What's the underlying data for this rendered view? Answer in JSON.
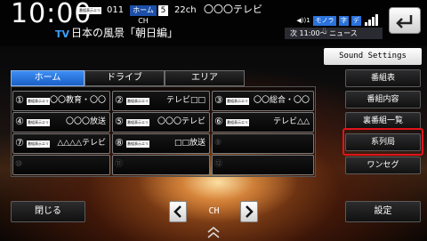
{
  "header": {
    "clock": "10:00",
    "tag": "番組表示エリア",
    "channel_code": "011",
    "home_ch_label": "ホームCH",
    "home_ch_num": "5",
    "channel_no": "22ch",
    "station": "〇〇〇テレビ",
    "tv_label": "TV",
    "program_title": "日本の風景「朝日編」",
    "status": {
      "signal": "◀))1",
      "mode": "モノラル",
      "subtitle": "字",
      "data": "デ"
    },
    "next_program": "次 11:00〜 ニュース"
  },
  "sound_settings": "Sound Settings",
  "tabs": [
    {
      "label": "ホーム",
      "active": true
    },
    {
      "label": "ドライブ",
      "active": false
    },
    {
      "label": "エリア",
      "active": false
    }
  ],
  "presets": [
    {
      "num": "①",
      "name": "〇〇教育・〇〇",
      "tag": "番組表示エリア"
    },
    {
      "num": "②",
      "name": "テレビ□□",
      "tag": "番組表示エリア"
    },
    {
      "num": "③",
      "name": "〇〇総合・〇〇",
      "tag": "番組表示エリア"
    },
    {
      "num": "④",
      "name": "〇〇〇放送",
      "tag": "番組表示エリア"
    },
    {
      "num": "⑤",
      "name": "〇〇〇テレビ",
      "tag": "番組表示エリア"
    },
    {
      "num": "⑥",
      "name": "テレビ△△",
      "tag": "番組表示エリア"
    },
    {
      "num": "⑦",
      "name": "△△△△テレビ",
      "tag": "番組表示エリア"
    },
    {
      "num": "⑧",
      "name": "□□放送",
      "tag": "番組表示エリア"
    },
    {
      "num": "⑨",
      "name": "",
      "tag": ""
    },
    {
      "num": "⑩",
      "name": "",
      "tag": ""
    },
    {
      "num": "⑪",
      "name": "",
      "tag": ""
    },
    {
      "num": "⑫",
      "name": "",
      "tag": ""
    }
  ],
  "side_menu": [
    "番組表",
    "番組内容",
    "裏番組一覧",
    "系列局",
    "ワンセグ"
  ],
  "highlighted_item": "系列局",
  "bottom": {
    "close": "閉じる",
    "ch": "CH",
    "prev_icon": "chevron-left-icon",
    "next_icon": "chevron-right-icon",
    "settings": "設定"
  },
  "colors": {
    "accent_blue": "#2a72dc",
    "highlight_red": "#e0141a",
    "tv_blue": "#3aa0ff"
  }
}
